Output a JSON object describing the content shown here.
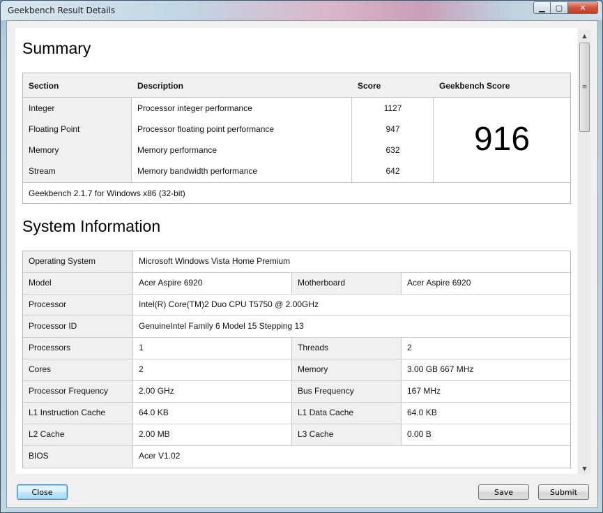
{
  "window": {
    "title": "Geekbench Result Details",
    "controls": {
      "minimize": "▁",
      "maximize": "▢",
      "close": "✕"
    }
  },
  "summary": {
    "heading": "Summary",
    "columns": {
      "section": "Section",
      "description": "Description",
      "score": "Score",
      "geekbench": "Geekbench Score"
    },
    "rows": [
      {
        "section": "Integer",
        "description": "Processor integer performance",
        "score": "1127"
      },
      {
        "section": "Floating Point",
        "description": "Processor floating point performance",
        "score": "947"
      },
      {
        "section": "Memory",
        "description": "Memory performance",
        "score": "632"
      },
      {
        "section": "Stream",
        "description": "Memory bandwidth performance",
        "score": "642"
      }
    ],
    "geekbench_score": "916",
    "footer": "Geekbench 2.1.7 for Windows x86 (32-bit)"
  },
  "system_information": {
    "heading": "System Information",
    "rows": [
      {
        "label": "Operating System",
        "value": "Microsoft Windows Vista Home Premium"
      },
      {
        "label": "Model",
        "value": "Acer Aspire 6920",
        "label2": "Motherboard",
        "value2": "Acer Aspire 6920"
      },
      {
        "label": "Processor",
        "value": "Intel(R) Core(TM)2 Duo CPU T5750 @ 2.00GHz"
      },
      {
        "label": "Processor ID",
        "value": "GenuineIntel Family 6 Model 15 Stepping 13"
      },
      {
        "label": "Processors",
        "value": "1",
        "label2": "Threads",
        "value2": "2"
      },
      {
        "label": "Cores",
        "value": "2",
        "label2": "Memory",
        "value2": "3.00 GB   667 MHz"
      },
      {
        "label": "Processor Frequency",
        "value": "2.00 GHz",
        "label2": "Bus Frequency",
        "value2": "167 MHz"
      },
      {
        "label": "L1 Instruction Cache",
        "value": "64.0 KB",
        "label2": "L1 Data Cache",
        "value2": "64.0 KB"
      },
      {
        "label": "L2 Cache",
        "value": "2.00 MB",
        "label2": "L3 Cache",
        "value2": "0.00 B"
      },
      {
        "label": "BIOS",
        "value": "Acer V1.02"
      }
    ]
  },
  "scrollbar": {
    "up": "▲",
    "down": "▼",
    "grip": "≡"
  },
  "buttons": {
    "close": "Close",
    "save": "Save",
    "submit": "Submit"
  }
}
